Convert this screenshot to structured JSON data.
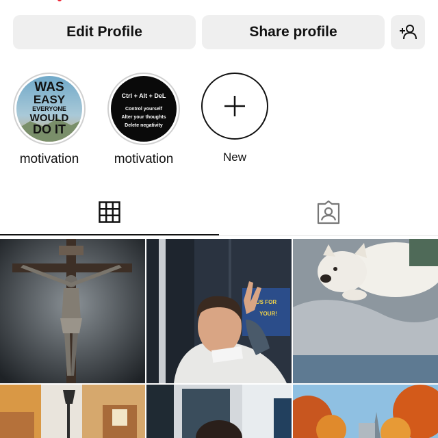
{
  "actions": {
    "edit_profile": "Edit Profile",
    "share_profile": "Share profile",
    "add_person_icon": "add-person-icon"
  },
  "highlights": [
    {
      "label": "motivation",
      "cover_text": [
        "WAS",
        "EASY",
        "EVERYONE",
        "WOULD",
        "DO IT"
      ]
    },
    {
      "label": "motivation",
      "cover_text": [
        "Ctrl + Alt + DeL",
        "Control yourself",
        "Alter your thoughts",
        "Delete negativity"
      ]
    }
  ],
  "new_highlight": {
    "label": "New",
    "icon": "plus-icon"
  },
  "tabs": [
    {
      "icon": "grid-icon",
      "selected": true
    },
    {
      "icon": "tagged-person-icon",
      "selected": false
    }
  ],
  "posts": [
    {
      "subject": "crucifix"
    },
    {
      "subject": "man-with-card",
      "sign_text": [
        "US FOR",
        "YOUR!"
      ]
    },
    {
      "subject": "white-dog"
    },
    {
      "subject": "street-lamp"
    },
    {
      "subject": "man-doorway"
    },
    {
      "subject": "autumn-trees"
    }
  ],
  "colors": {
    "button_bg": "#efefef",
    "text": "#111111",
    "tab_indicator": "#111111"
  }
}
